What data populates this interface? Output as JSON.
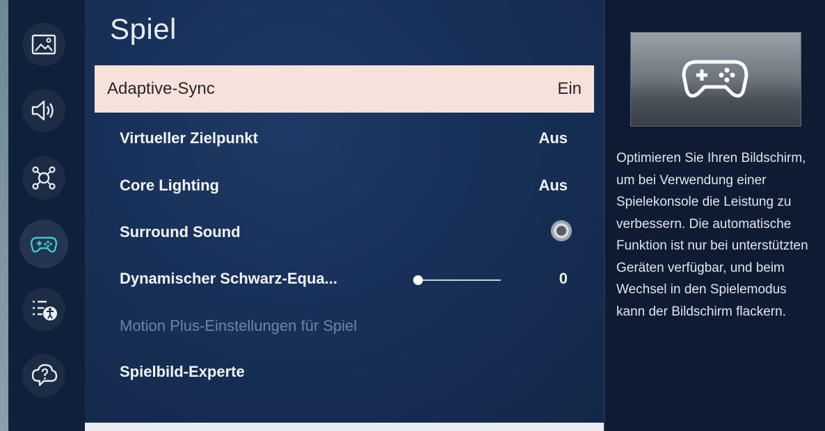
{
  "sidebar": {
    "items": [
      {
        "icon": "picture-icon"
      },
      {
        "icon": "sound-icon"
      },
      {
        "icon": "network-icon"
      },
      {
        "icon": "gamepad-icon",
        "active": true
      },
      {
        "icon": "accessibility-icon"
      },
      {
        "icon": "support-icon"
      }
    ]
  },
  "menu": {
    "title": "Spiel",
    "items": [
      {
        "label": "Adaptive-Sync",
        "value": "Ein"
      },
      {
        "label": "Virtueller Zielpunkt",
        "value": "Aus"
      },
      {
        "label": "Core Lighting",
        "value": "Aus"
      },
      {
        "label": "Surround Sound",
        "toggle": "off"
      },
      {
        "label": "Dynamischer Schwarz-Equa...",
        "value": "0",
        "slider_level": 0
      },
      {
        "label": "Motion Plus-Einstellungen für Spiel",
        "disabled": true
      },
      {
        "label": "Spielbild-Experte"
      }
    ]
  },
  "info": {
    "image_icon": "gamepad-icon",
    "description": "Optimieren Sie Ihren Bildschirm, um bei Verwendung einer Spielekonsole die Leistung zu verbessern. Die automatische Funktion ist nur bei unterstützten Geräten verfügbar, und beim Wechsel in den Spielemodus kann der Bildschirm flackern."
  },
  "colors": {
    "selected_background": "#f6e2da",
    "menu_background": "#183058",
    "disabled_text": "#6d84a8"
  }
}
